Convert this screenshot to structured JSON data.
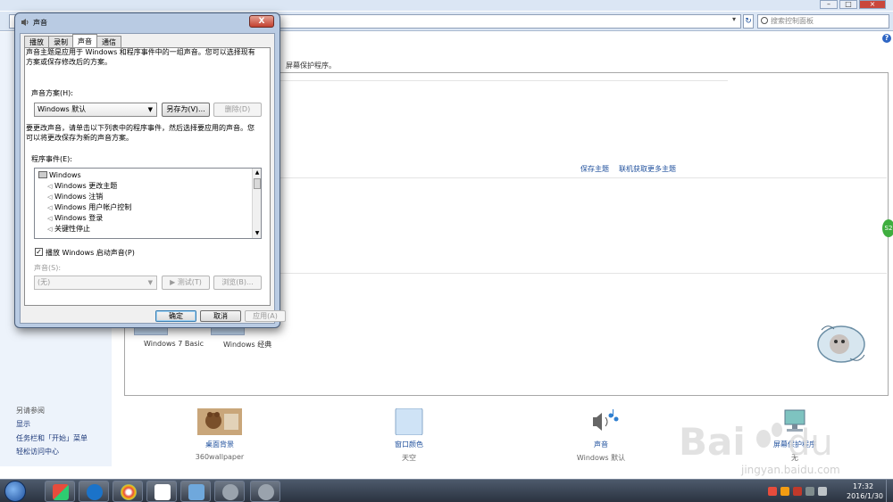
{
  "background_window": {
    "search_placeholder": "搜索控制面板",
    "help_label": "?",
    "description_fragment": "屏幕保护程序。",
    "see_also_title": "另请参阅",
    "side_links": [
      "显示",
      "任务栏和「开始」菜单",
      "轻松访问中心"
    ],
    "theme_links": [
      "保存主题",
      "联机获取更多主题"
    ],
    "basic_themes": [
      "Windows 7 Basic",
      "Windows 经典"
    ],
    "bottom_items": [
      {
        "label": "桌面背景",
        "sub": "360wallpaper"
      },
      {
        "label": "窗口颜色",
        "sub": "天空"
      },
      {
        "label": "声音",
        "sub": "Windows 默认"
      },
      {
        "label": "屏幕保护程序",
        "sub": "无"
      }
    ],
    "side_badge": "S2"
  },
  "dialog": {
    "title": "声音",
    "close_label": "X",
    "tabs": [
      {
        "label": "播放",
        "active": false
      },
      {
        "label": "录制",
        "active": false
      },
      {
        "label": "声音",
        "active": true
      },
      {
        "label": "通信",
        "active": false
      }
    ],
    "intro_text": "声音主题是应用于 Windows 和程序事件中的一组声音。您可以选择现有方案或保存修改后的方案。",
    "scheme_label": "声音方案(H):",
    "scheme_value": "Windows 默认",
    "saveas_label": "另存为(V)...",
    "delete_label": "删除(D)",
    "change_text": "要更改声音，请单击以下列表中的程序事件，然后选择要应用的声音。您可以将更改保存为新的声音方案。",
    "events_label": "程序事件(E):",
    "events": [
      {
        "label": "Windows",
        "group": true
      },
      {
        "label": "Windows 更改主题",
        "group": false
      },
      {
        "label": "Windows 注销",
        "group": false
      },
      {
        "label": "Windows 用户帐户控制",
        "group": false
      },
      {
        "label": "Windows 登录",
        "group": false
      },
      {
        "label": "关键性停止",
        "group": false
      }
    ],
    "play_startup_label": "播放 Windows 启动声音(P)",
    "play_startup_checked": true,
    "sound_label": "声音(S):",
    "sound_value": "(无)",
    "test_label": "测试(T)",
    "browse_label": "浏览(B)...",
    "ok_label": "确定",
    "cancel_label": "取消",
    "apply_label": "应用(A)"
  },
  "taskbar": {
    "time": "17:32",
    "date": "2016/1/30"
  },
  "watermark": {
    "url": "jingyan.baidu.com"
  },
  "colors": {
    "link_blue": "#1e4f9c",
    "close_red": "#c2402f",
    "taskbar": "#2b3340"
  }
}
